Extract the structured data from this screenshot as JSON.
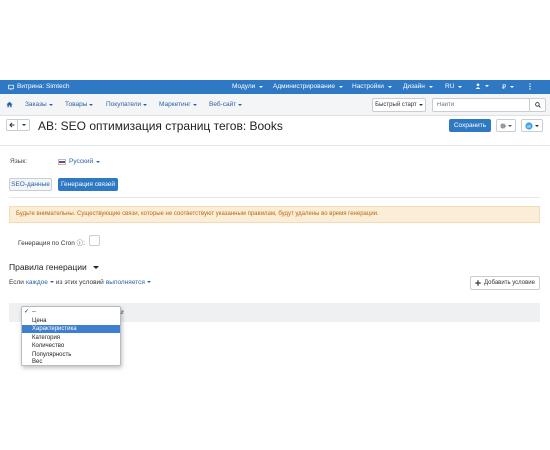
{
  "topbar": {
    "brand": "Витрина: Simtech",
    "menus": [
      "Модули",
      "Администрирование",
      "Настройки",
      "Дизайн",
      "RU"
    ],
    "icons": [
      "user-icon",
      "currency-icon"
    ],
    "currency": "₽"
  },
  "menubar": {
    "home_icon": "home-icon",
    "items": [
      "Заказы",
      "Товары",
      "Покупатели",
      "Маркетинг",
      "Веб-сайт"
    ],
    "quick_start": "Быстрый старт",
    "search_placeholder": "Найти"
  },
  "titlebar": {
    "title": "AB: SEO оптимизация страниц тегов: Books",
    "save_label": "Сохранить"
  },
  "content": {
    "language_label": "Язык:",
    "language_value": "Русский",
    "tabs": [
      "SEO-данные",
      "Генерация связей"
    ],
    "active_tab": 1,
    "warning_text": "Будьте внимательны. Существующие связи, которые не соответствуют указанным правилам, будут удалены во время генерации.",
    "cron_label": "Генерация по Cron",
    "cron_help_icon": "question-icon",
    "rules_title": "Правила генерации",
    "condition_prefix": "Если",
    "condition_every": "каждое",
    "condition_middle": "из этих условий",
    "condition_state": "выполняется",
    "add_condition": "Добавить условие"
  },
  "dropdown": {
    "options": [
      "--",
      "Цена",
      "Характеристика",
      "Категория",
      "Количество",
      "Популярность",
      "Вес"
    ],
    "checked_index": 0,
    "highlighted_index": 2
  },
  "colors": {
    "brand_blue": "#2f78c4",
    "warning_bg": "#fbedd6",
    "warning_text": "#b86b12"
  }
}
